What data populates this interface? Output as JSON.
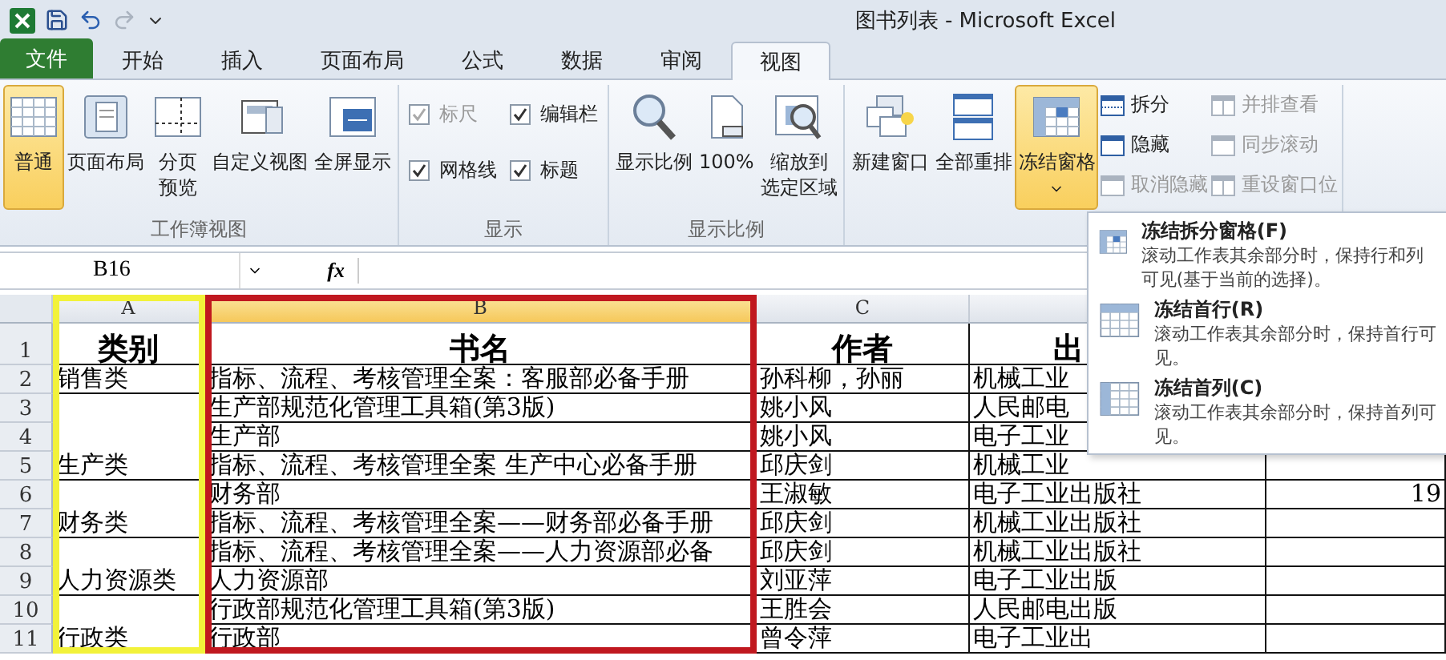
{
  "window": {
    "title": "图书列表 - Microsoft Excel"
  },
  "tabs": [
    {
      "label": "文件",
      "kind": "file",
      "selected": false
    },
    {
      "label": "开始",
      "kind": "tab",
      "selected": false
    },
    {
      "label": "插入",
      "kind": "tab",
      "selected": false
    },
    {
      "label": "页面布局",
      "kind": "tab",
      "selected": false
    },
    {
      "label": "公式",
      "kind": "tab",
      "selected": false
    },
    {
      "label": "数据",
      "kind": "tab",
      "selected": false
    },
    {
      "label": "审阅",
      "kind": "tab",
      "selected": false
    },
    {
      "label": "视图",
      "kind": "tab",
      "selected": true
    }
  ],
  "ribbon": [
    {
      "label": "工作簿视图",
      "kind": "buttons",
      "items": [
        {
          "lines": [
            "普通"
          ],
          "selected": true
        },
        {
          "lines": [
            "页面布局"
          ],
          "selected": false
        },
        {
          "lines": [
            "分页",
            "预览"
          ],
          "selected": false
        },
        {
          "lines": [
            "自定义视图"
          ],
          "selected": false
        },
        {
          "lines": [
            "全屏显示"
          ],
          "selected": false
        }
      ]
    },
    {
      "label": "显示",
      "kind": "checks",
      "items": [
        {
          "label": "标尺",
          "checked": true,
          "disabled": true
        },
        {
          "label": "编辑栏",
          "checked": true,
          "disabled": false
        },
        {
          "label": "网格线",
          "checked": true,
          "disabled": false
        },
        {
          "label": "标题",
          "checked": true,
          "disabled": false
        }
      ]
    },
    {
      "label": "显示比例",
      "kind": "buttons",
      "items": [
        {
          "lines": [
            "显示比例"
          ],
          "selected": false
        },
        {
          "lines": [
            "100%"
          ],
          "selected": false
        },
        {
          "lines": [
            "缩放到",
            "选定区域"
          ],
          "selected": false
        }
      ]
    },
    {
      "kind": "window",
      "items": [
        {
          "lines": [
            "新建窗口"
          ],
          "selected": false
        },
        {
          "lines": [
            "全部重排"
          ],
          "selected": false
        },
        {
          "lines": [
            "冻结窗格"
          ],
          "selected": true,
          "dropdown": true
        }
      ],
      "small": [
        {
          "label": "拆分",
          "disabled": false
        },
        {
          "label": "隐藏",
          "disabled": false
        },
        {
          "label": "取消隐藏",
          "disabled": true
        },
        {
          "label": "并排查看",
          "disabled": true
        },
        {
          "label": "同步滚动",
          "disabled": true
        },
        {
          "label": "重设窗口位",
          "disabled": true
        }
      ]
    }
  ],
  "formula_bar": {
    "name_box": "B16",
    "function_label": "fx"
  },
  "sheet": {
    "columns": [
      {
        "label": "A",
        "selected": false,
        "color": "#f2f23a"
      },
      {
        "label": "B",
        "selected": true,
        "color": "#c0181f"
      },
      {
        "label": "C",
        "selected": false
      }
    ],
    "header": {
      "number": "1",
      "cells": [
        "类别",
        "书名",
        "作者",
        "出"
      ]
    },
    "groups": [
      {
        "category": "销售类",
        "rows": [
          {
            "number": "2",
            "cells": [
              "指标、流程、考核管理全案：客服部必备手册",
              "孙科柳，孙丽",
              "机械工业"
            ]
          }
        ]
      },
      {
        "category": "生产类",
        "rows": [
          {
            "number": "3",
            "cells": [
              "生产部规范化管理工具箱(第3版)",
              "姚小风",
              "人民邮电"
            ]
          },
          {
            "number": "4",
            "cells": [
              "生产部",
              "姚小风",
              "电子工业"
            ]
          },
          {
            "number": "5",
            "cells": [
              "指标、流程、考核管理全案 生产中心必备手册",
              "邱庆剑",
              "机械工业"
            ]
          }
        ]
      },
      {
        "category": "财务类",
        "rows": [
          {
            "number": "6",
            "cells": [
              "财务部",
              "王淑敏",
              "电子工业出版社",
              "19"
            ]
          },
          {
            "number": "7",
            "cells": [
              "指标、流程、考核管理全案——财务部必备手册",
              "邱庆剑",
              "机械工业出版社"
            ]
          }
        ]
      },
      {
        "category": "人力资源类",
        "rows": [
          {
            "number": "8",
            "cells": [
              "指标、流程、考核管理全案——人力资源部必备",
              "邱庆剑",
              "机械工业出版社"
            ]
          },
          {
            "number": "9",
            "cells": [
              "人力资源部",
              "刘亚萍",
              "电子工业出版"
            ]
          }
        ]
      },
      {
        "category": "行政类",
        "rows": [
          {
            "number": "10",
            "cells": [
              "行政部规范化管理工具箱(第3版)",
              "王胜会",
              "人民邮电出版"
            ]
          },
          {
            "number": "11",
            "cells": [
              "行政部",
              "曾令萍",
              "电子工业出"
            ]
          }
        ]
      }
    ]
  },
  "menu": {
    "items": [
      {
        "title": "冻结拆分窗格(F)",
        "description": "滚动工作表其余部分时，保持行和列可见(基于当前的选择)。"
      },
      {
        "title": "冻结首行(R)",
        "description": "滚动工作表其余部分时，保持首行可见。"
      },
      {
        "title": "冻结首列(C)",
        "description": "滚动工作表其余部分时，保持首列可见。"
      }
    ]
  }
}
